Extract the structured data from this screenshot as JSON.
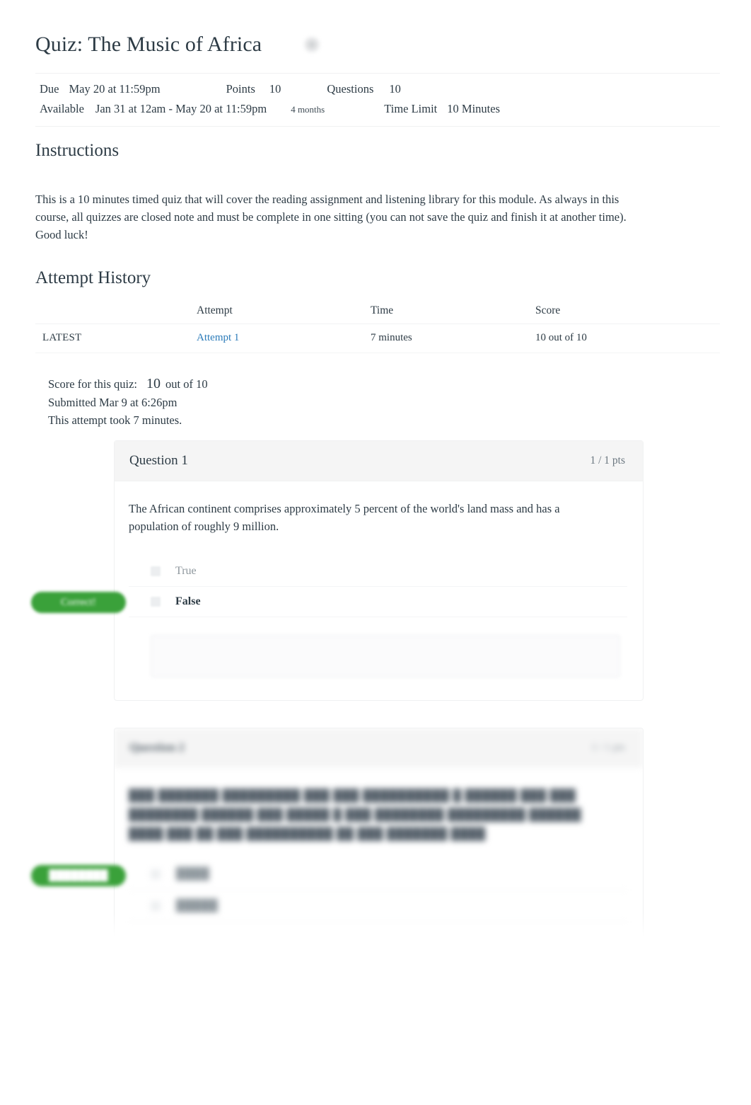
{
  "header": {
    "title": "Quiz: The Music of Africa",
    "title_icon": "blurred-circle-icon",
    "meta": {
      "due_label": "Due",
      "due_value": "May 20 at 11:59pm",
      "points_label": "Points",
      "points_value": "10",
      "questions_label": "Questions",
      "questions_value": "10",
      "available_label": "Available",
      "available_value": "Jan 31 at 12am - May 20 at 11:59pm",
      "duration": "4 months",
      "time_limit_label": "Time Limit",
      "time_limit_value": "10 Minutes"
    }
  },
  "instructions": {
    "heading": "Instructions",
    "body": "This is a 10 minutes timed quiz that will cover the reading assignment and listening library for this module. As always in this course, all quizzes are closed note and must be complete in one sitting (you can not save the quiz and finish it at another time). Good luck!"
  },
  "attempt_history": {
    "heading": "Attempt History",
    "columns": [
      "",
      "Attempt",
      "Time",
      "Score"
    ],
    "rows": [
      {
        "kept": "LATEST",
        "attempt": "Attempt 1",
        "time": "7 minutes",
        "score": "10 out of 10"
      }
    ]
  },
  "score_summary": {
    "score_label": "Score for this quiz:",
    "score_value": "10",
    "score_out_of": "out of 10",
    "submitted": "Submitted Mar 9 at 6:26pm",
    "duration": "This attempt took 7 minutes."
  },
  "questions": [
    {
      "title": "Question 1",
      "points": "1 / 1 pts",
      "text": "The African continent comprises approximately 5 percent of the world's land mass and has a population of roughly 9 million.",
      "badge": "Correct!",
      "answers": [
        {
          "label": "True",
          "selected": false
        },
        {
          "label": "False",
          "selected": true
        }
      ],
      "feedback": ""
    },
    {
      "title": "Question 2",
      "points": "1 / 1 pts",
      "text": "███ ███████ █████████ ███ ███ ██████████ █ ██████ ███ ███ ████████ ██████ ███ █████ █ ███ ████████ █████████ ██████ ████ ███ ██ ███ ██████████ ██ ███ ███████ ████",
      "badge": "████████",
      "answers": [
        {
          "label": "████",
          "selected": false
        },
        {
          "label": "█████",
          "selected": false
        }
      ],
      "feedback": ""
    }
  ]
}
